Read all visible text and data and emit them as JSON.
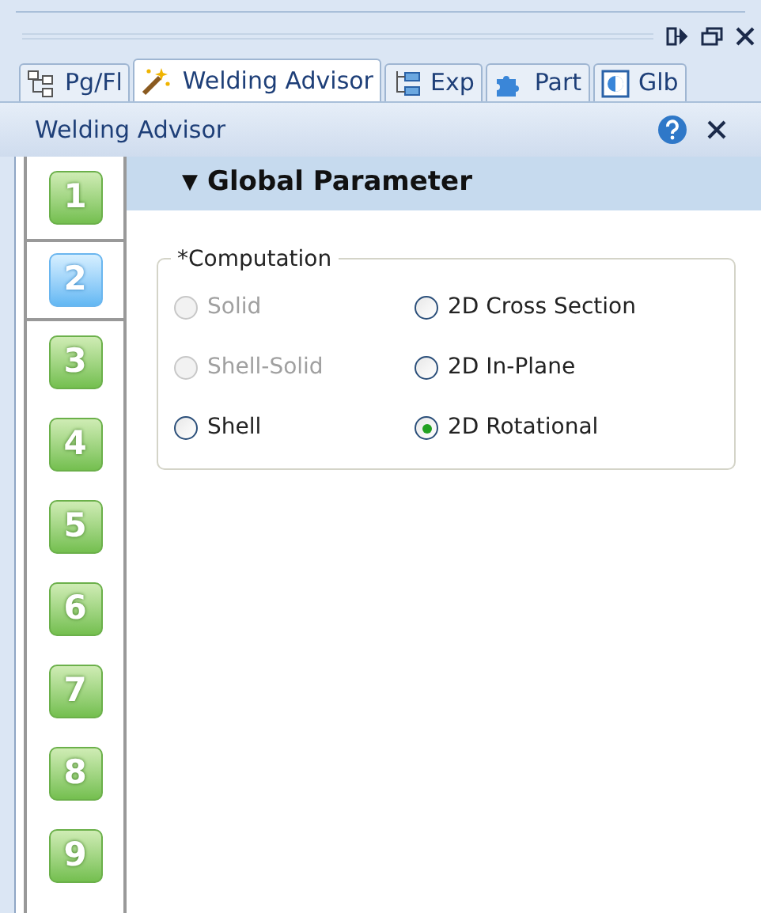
{
  "tabs": [
    {
      "label": "Pg/Fl",
      "kind": "tree",
      "selected": false
    },
    {
      "label": "Welding Advisor",
      "kind": "wand",
      "selected": true
    },
    {
      "label": "Exp",
      "kind": "tree2",
      "selected": false
    },
    {
      "label": "Part",
      "kind": "puzzle",
      "selected": false
    },
    {
      "label": "Glb",
      "kind": "box",
      "selected": false
    }
  ],
  "panel": {
    "title": "Welding Advisor"
  },
  "steps": [
    {
      "label": "1",
      "selected": false
    },
    {
      "label": "2",
      "selected": true
    },
    {
      "label": "3",
      "selected": false
    },
    {
      "label": "4",
      "selected": false
    },
    {
      "label": "5",
      "selected": false
    },
    {
      "label": "6",
      "selected": false
    },
    {
      "label": "7",
      "selected": false
    },
    {
      "label": "8",
      "selected": false
    },
    {
      "label": "9",
      "selected": false
    }
  ],
  "section": {
    "arrow": "▼",
    "title": "Global Parameter",
    "expanded": true
  },
  "group": {
    "legend": "*Computation",
    "options": [
      {
        "label": "Solid",
        "selected": false,
        "disabled": true
      },
      {
        "label": "2D Cross Section",
        "selected": false,
        "disabled": false
      },
      {
        "label": "Shell-Solid",
        "selected": false,
        "disabled": true
      },
      {
        "label": "2D In-Plane",
        "selected": false,
        "disabled": false
      },
      {
        "label": "Shell",
        "selected": false,
        "disabled": false
      },
      {
        "label": "2D Rotational",
        "selected": true,
        "disabled": false
      }
    ]
  }
}
